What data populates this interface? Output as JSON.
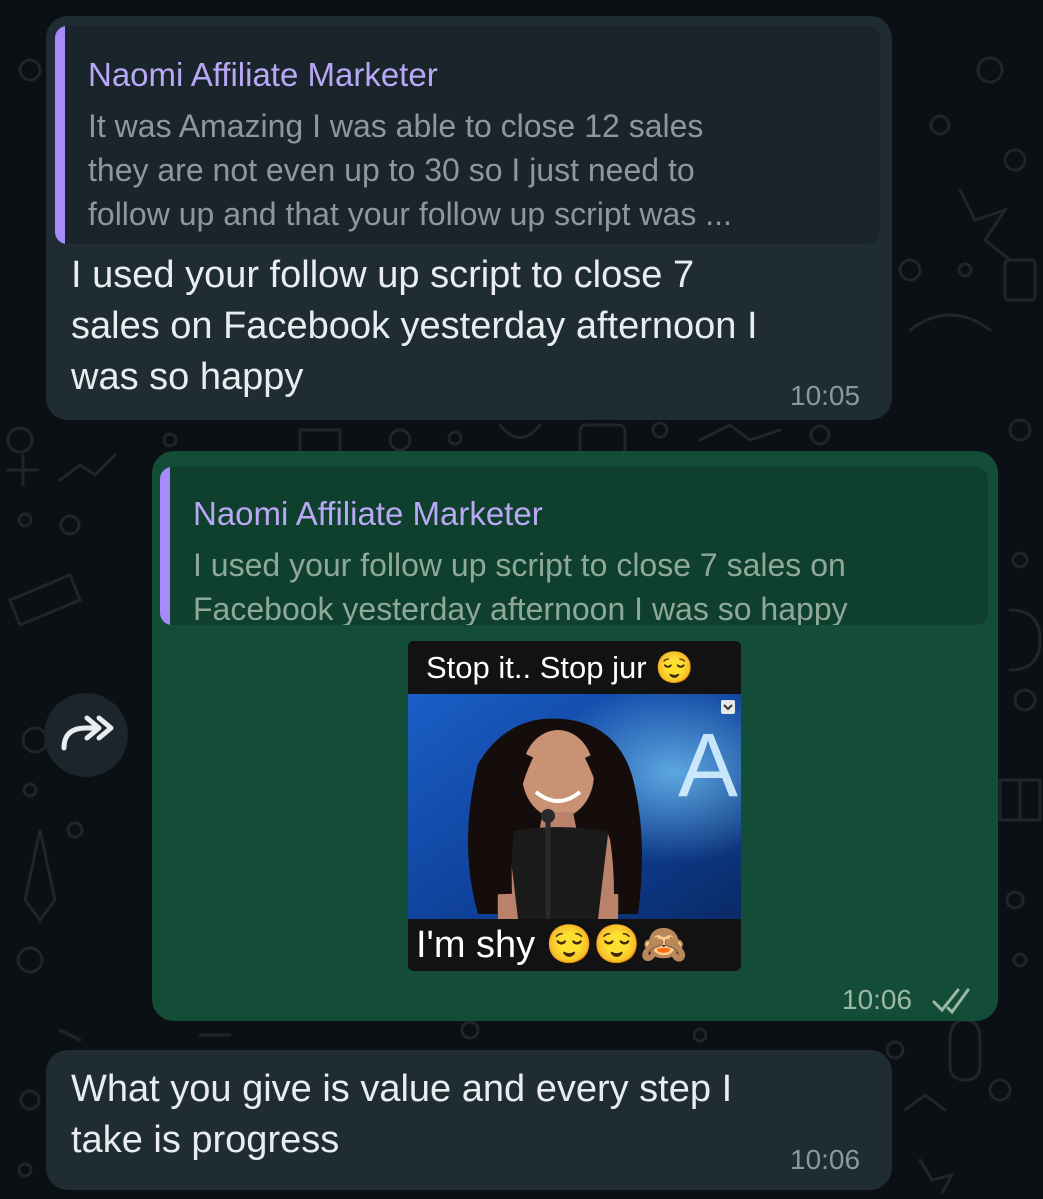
{
  "messages": [
    {
      "type": "incoming",
      "quote": {
        "author": "Naomi Affiliate Marketer",
        "lines": [
          "It was Amazing  I was able to close 12  sales",
          "they are not even up to 30 so I just need to",
          "follow up and that your follow up script was ..."
        ]
      },
      "lines": [
        "I used your follow up script to close 7",
        "sales on Facebook yesterday afternoon I",
        "was so happy"
      ],
      "time": "10:05"
    },
    {
      "type": "outgoing",
      "quote": {
        "author": "Naomi Affiliate Marketer",
        "lines": [
          "I used your follow up script to close 7 sales on",
          "Facebook yesterday afternoon I was so happy"
        ]
      },
      "sticker": {
        "top_caption": "Stop it.. Stop jur 😌",
        "bottom_caption": "I'm shy  😌😌🙈",
        "backdrop_text": "AI-"
      },
      "time": "10:06",
      "status_icon": "double-check-icon"
    },
    {
      "type": "incoming",
      "lines": [
        "What you give is value and every step I",
        "take is progress"
      ],
      "time": "10:06"
    }
  ],
  "forward_icon": "forward-arrow-icon",
  "colors": {
    "incoming_bubble": "#1f2c33",
    "outgoing_bubble": "#144d37",
    "quote_accent": "#a78bfa"
  }
}
